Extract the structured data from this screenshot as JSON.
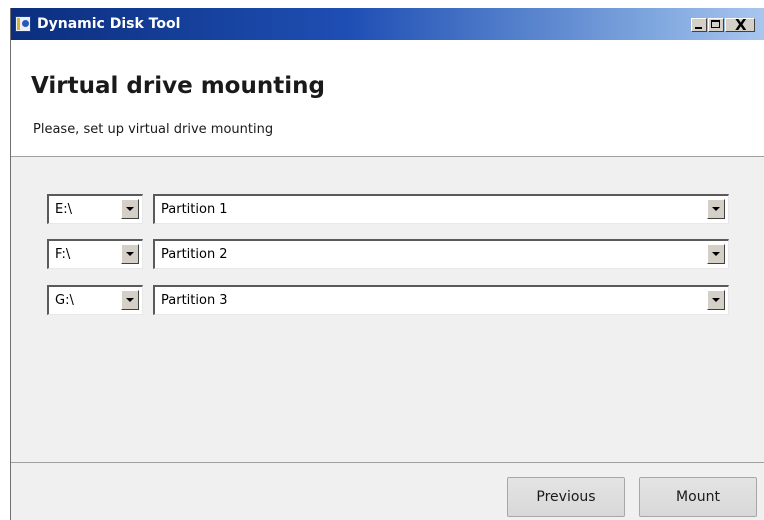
{
  "window": {
    "title": "Dynamic Disk Tool",
    "title_buttons": {
      "minimize": "_",
      "maximize": "□",
      "close": "X"
    }
  },
  "header": {
    "title": "Virtual drive mounting",
    "subtitle": "Please, set up virtual drive mounting"
  },
  "mappings": [
    {
      "drive": "E:\\",
      "partition": "Partition 1"
    },
    {
      "drive": "F:\\",
      "partition": "Partition 2"
    },
    {
      "drive": "G:\\",
      "partition": "Partition 3"
    }
  ],
  "buttons": {
    "previous": "Previous",
    "mount": "Mount"
  },
  "colors": {
    "titlebar_start": "#0b2e7e",
    "titlebar_end": "#a9c6ee",
    "header_bg": "#ffffff",
    "body_bg": "#f0f0f0"
  }
}
